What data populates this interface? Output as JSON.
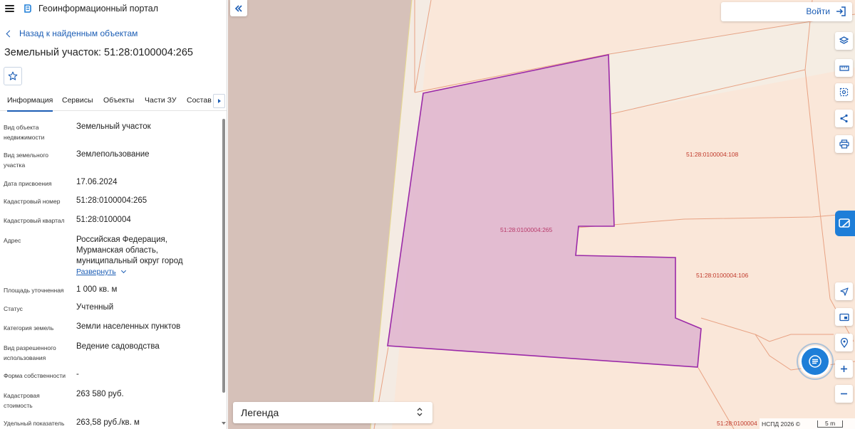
{
  "header": {
    "portal_title": "Геоинформационный портал"
  },
  "nav": {
    "back_label": "Назад к найденным объектам"
  },
  "object": {
    "title": "Земельный участок: 51:28:0100004:265"
  },
  "tabs": [
    {
      "label": "Информация",
      "active": true
    },
    {
      "label": "Сервисы"
    },
    {
      "label": "Объекты"
    },
    {
      "label": "Части ЗУ"
    },
    {
      "label": "Состав"
    }
  ],
  "properties": [
    {
      "label": "Вид объекта недвижимости",
      "value": "Земельный участок"
    },
    {
      "label": "Вид земельного участка",
      "value": "Землепользование"
    },
    {
      "label": "Дата присвоения",
      "value": "17.06.2024"
    },
    {
      "label": "Кадастровый номер",
      "value": "51:28:0100004:265"
    },
    {
      "label": "Кадастровый квартал",
      "value": "51:28:0100004"
    },
    {
      "label": "Адрес",
      "value": "Российская Федерация, Мурманская область, муниципальный округ город Полярные Зори, населенный"
    },
    {
      "label": "Площадь уточненная",
      "value": "1 000 кв. м"
    },
    {
      "label": "Статус",
      "value": "Учтенный"
    },
    {
      "label": "Категория земель",
      "value": "Земли населенных пунктов"
    },
    {
      "label": "Вид разрешенного использования",
      "value": "Ведение садоводства"
    },
    {
      "label": "Форма собственности",
      "value": "-"
    },
    {
      "label": "Кадастровая стоимость",
      "value": "263 580 руб."
    },
    {
      "label": "Удельный показатель",
      "value": "263,58 руб./кв. м"
    }
  ],
  "address_expand_label": "Развернуть",
  "map": {
    "login_label": "Войти",
    "legend_label": "Легенда",
    "attribution": "НСПД 2026 ©",
    "scale_label": "5 m",
    "parcel_labels": {
      "selected": "51:28:0100004:265",
      "p108": "51:28:0100004:108",
      "p106": "51:28:0100004:106",
      "bottom": "51:28:0100004"
    },
    "colors": {
      "selected_fill": "#e2b9d1",
      "selected_stroke": "#9b2aa8",
      "parcel_fill": "#fae7d9",
      "parcel_stroke": "#e8a283",
      "road": "#d6c1b9",
      "accent": "#1e7ed8"
    },
    "tools": [
      "layers-icon",
      "ruler-icon",
      "select-area-icon",
      "share-icon",
      "print-icon",
      "locate-icon",
      "map-view-icon",
      "geo-pin-icon",
      "zoom-in-icon",
      "zoom-out-icon"
    ]
  }
}
